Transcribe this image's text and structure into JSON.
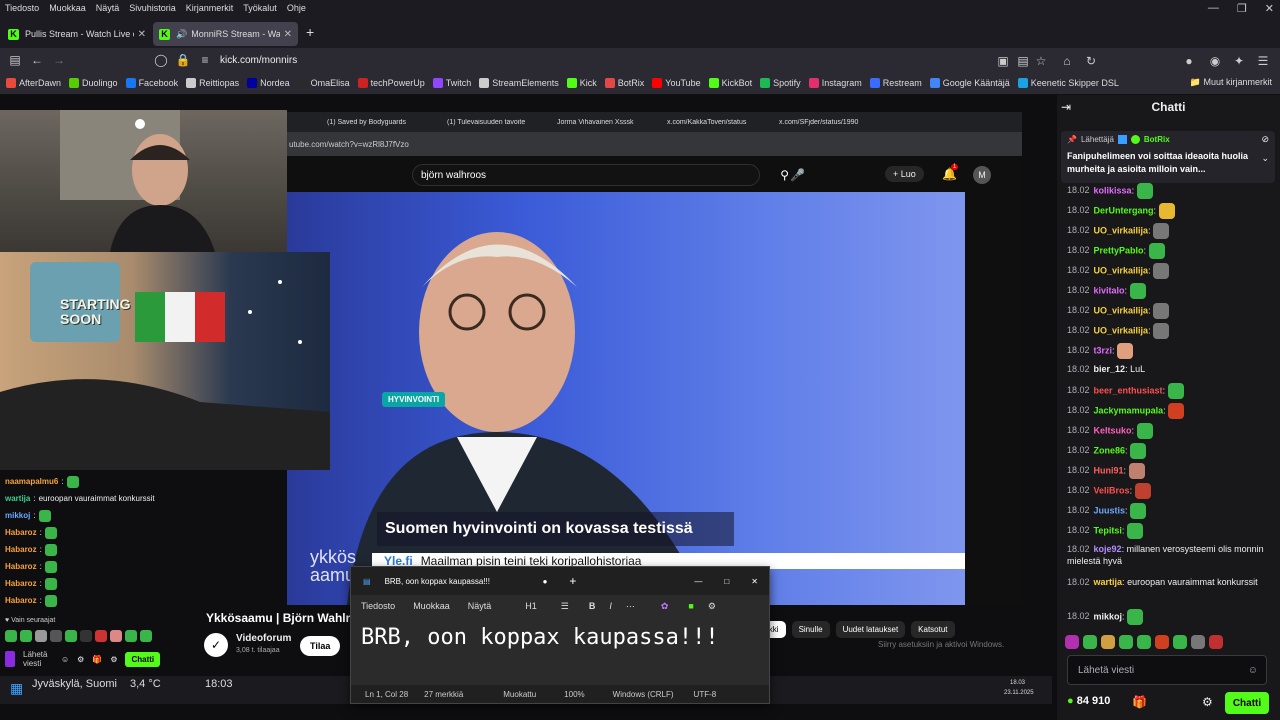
{
  "menubar": {
    "items": [
      "Tiedosto",
      "Muokkaa",
      "Näytä",
      "Sivuhistoria",
      "Kirjanmerkit",
      "Työkalut",
      "Ohje"
    ]
  },
  "tabs": [
    {
      "title": "Pullis Stream - Watch Live o",
      "active": false
    },
    {
      "title": "MonniRS Stream - Watch L",
      "active": true
    }
  ],
  "url": "kick.com/monnirs",
  "bookmarks": [
    {
      "label": "AfterDawn",
      "color": "#e84b3c"
    },
    {
      "label": "Duolingo",
      "color": "#58cc02"
    },
    {
      "label": "Facebook",
      "color": "#1877f2"
    },
    {
      "label": "Reittiopas",
      "color": "#cccccc"
    },
    {
      "label": "Nordea",
      "color": "#0000a0"
    },
    {
      "label": "OmaElisa",
      "color": "#2a2a2a"
    },
    {
      "label": "techPowerUp",
      "color": "#cc2222"
    },
    {
      "label": "Twitch",
      "color": "#9146ff"
    },
    {
      "label": "StreamElements",
      "color": "#cccccc"
    },
    {
      "label": "Kick",
      "color": "#53fc18"
    },
    {
      "label": "BotRix",
      "color": "#e34848"
    },
    {
      "label": "YouTube",
      "color": "#ff0000"
    },
    {
      "label": "KickBot",
      "color": "#53fc18"
    },
    {
      "label": "Spotify",
      "color": "#1db954"
    },
    {
      "label": "Instagram",
      "color": "#e1306c"
    },
    {
      "label": "Restream",
      "color": "#3a6bff"
    },
    {
      "label": "Google Kääntäjä",
      "color": "#4285f4"
    },
    {
      "label": "Keenetic Skipper DSL",
      "color": "#1aa3e0"
    }
  ],
  "other_bookmarks": "Muut kirjanmerkit",
  "stream": {
    "starting_soon": "STARTING SOON",
    "yt_tabs": [
      "(1) Saved by Bodyguards",
      "(1) Tulevaisuuden tavoite",
      "Jorma Vihavainen Xsssk",
      "x.com/KakkaToveri/status",
      "x.com/SFjder/status/1990"
    ],
    "yt_url": "utube.com/watch?v=wzRl8J7fVzo",
    "yt_search": "björn walhroos",
    "yt_create": "Luo",
    "yt_notif": "1",
    "yt_avatar": "M",
    "tag": "HYVINVOINTI",
    "headline": "Suomen hyvinvointi on kovassa testissä",
    "ticker_source": "Yle.fi",
    "ticker_text": "Maailman pisin teini teki koripallohistoriaa",
    "yle_logo": "ykkös aamu",
    "video_title": "Ykkösaamu | Björn Wahlroo",
    "channel": "Videoforum",
    "subs": "3,08 t. tilaajaa",
    "subscribe": "Tilaa",
    "chips": [
      "ikki",
      "Sinulle",
      "Uudet lataukset",
      "Katsotut"
    ],
    "windows_notice": "Siirry asetuksiin ja aktivoi Windows.",
    "taskbar_location": "Jyväskylä, Suomi",
    "taskbar_temp": "3,4 °C",
    "taskbar_time": "18:03",
    "taskbar_clock": "18.03",
    "taskbar_date": "23.11.2025",
    "left_chat": [
      {
        "user": "naamapalmu6",
        "text": "",
        "color": "#f7a23b"
      },
      {
        "user": "wartija",
        "text": "euroopan vauraimmat konkurssit",
        "color": "#3dd08d"
      },
      {
        "user": "mikkoj",
        "text": "",
        "color": "#6aa8ff"
      },
      {
        "user": "Habaroz",
        "text": "",
        "color": "#f7a23b"
      },
      {
        "user": "Habaroz",
        "text": "",
        "color": "#f7a23b"
      },
      {
        "user": "Habaroz",
        "text": "",
        "color": "#f7a23b"
      },
      {
        "user": "Habaroz",
        "text": "",
        "color": "#f7a23b"
      },
      {
        "user": "Habaroz",
        "text": "",
        "color": "#f7a23b"
      }
    ],
    "left_chat_follow": "Vain seuraajat",
    "left_chat_send": "Lähetä viesti",
    "left_chat_btn": "Chatti"
  },
  "notepad": {
    "tab_title": "BRB, oon koppax kaupassa!!!",
    "menu": [
      "Tiedosto",
      "Muokkaa",
      "Näytä"
    ],
    "heading": "H1",
    "content": "BRB, oon koppax kaupassa!!!",
    "status": {
      "pos": "Ln 1, Col 28",
      "chars": "27 merkkiä",
      "mod": "Muokattu",
      "zoom": "100%",
      "eol": "Windows (CRLF)",
      "enc": "UTF-8"
    }
  },
  "chat": {
    "title": "Chatti",
    "pinned": {
      "label": "Lähettäjä",
      "bot": "BotRix",
      "text": "Fanipuhelimeen voi soittaa ideaoita huolia murheita ja asioita milloin vain..."
    },
    "messages": [
      {
        "ts": "18.02",
        "user": "kolikissa",
        "text": "",
        "color": "#e36bff",
        "emote": "#39b54a"
      },
      {
        "ts": "18.02",
        "user": "DerUntergang",
        "text": "",
        "color": "#53fc18",
        "emote": "#e8b830"
      },
      {
        "ts": "18.02",
        "user": "UO_virkailija",
        "text": "",
        "color": "#f7d23b",
        "emote": "#777777"
      },
      {
        "ts": "18.02",
        "user": "PrettyPablo",
        "text": "",
        "color": "#53fc18",
        "emote": "#39b54a"
      },
      {
        "ts": "18.02",
        "user": "UO_virkailija",
        "text": "",
        "color": "#f7d23b",
        "emote": "#777777"
      },
      {
        "ts": "18.02",
        "user": "kivitalo",
        "text": "",
        "color": "#e36bff",
        "emote": "#39b54a"
      },
      {
        "ts": "18.02",
        "user": "UO_virkailija",
        "text": "",
        "color": "#f7d23b",
        "emote": "#777777"
      },
      {
        "ts": "18.02",
        "user": "UO_virkailija",
        "text": "",
        "color": "#f7d23b",
        "emote": "#777777"
      },
      {
        "ts": "18.02",
        "user": "t3rzi",
        "text": "",
        "color": "#e36bff",
        "emote": "#e0a080"
      },
      {
        "ts": "18.02",
        "user": "bier_12",
        "text": "LuL",
        "color": "#efeff1",
        "emote": ""
      },
      {
        "ts": "18.02",
        "user": "beer_enthusiast",
        "text": "",
        "color": "#ff4f4f",
        "emote": "#39b54a"
      },
      {
        "ts": "18.02",
        "user": "Jackymamupala",
        "text": "",
        "color": "#53fc18",
        "emote": "#d04020"
      },
      {
        "ts": "18.02",
        "user": "Keltsuko",
        "text": "",
        "color": "#ff5fc0",
        "emote": "#39b54a"
      },
      {
        "ts": "18.02",
        "user": "Zone86",
        "text": "",
        "color": "#53fc18",
        "emote": "#39b54a"
      },
      {
        "ts": "18.02",
        "user": "Huni91",
        "text": "",
        "color": "#ff5f5f",
        "emote": "#c08070"
      },
      {
        "ts": "18.02",
        "user": "VeliBros",
        "text": "",
        "color": "#ff4f4f",
        "emote": "#c04030"
      },
      {
        "ts": "18.02",
        "user": "Juustis",
        "text": "",
        "color": "#6aa8ff",
        "emote": "#39b54a"
      },
      {
        "ts": "18.02",
        "user": "Tepitsi",
        "text": "",
        "color": "#53fc18",
        "emote": "#39b54a"
      },
      {
        "ts": "18.02",
        "user": "koje92",
        "text": "millanen verosysteemi olis monnin mielestä hyvä",
        "color": "#b38cff",
        "emote": ""
      },
      {
        "ts": "18.02",
        "user": "wartija",
        "text": "euroopan vauraimmat konkurssit",
        "color": "#f7d23b",
        "emote": ""
      },
      {
        "ts": "18.02",
        "user": "mikkoj",
        "text": "",
        "color": "#efeff1",
        "emote": "#39b54a"
      }
    ],
    "input_placeholder": "Lähetä viesti",
    "points": "84 910",
    "send": "Chatti"
  }
}
